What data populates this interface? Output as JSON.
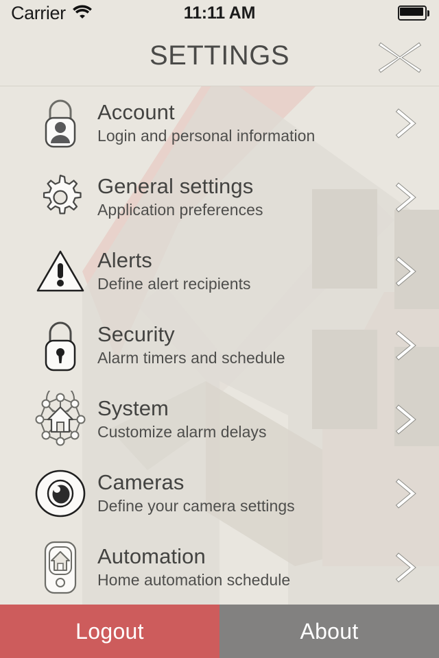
{
  "status_bar": {
    "carrier": "Carrier",
    "wifi_icon": "wifi-icon",
    "time": "11:11 AM",
    "battery_icon": "battery-full-icon"
  },
  "header": {
    "title": "SETTINGS",
    "close_icon": "close-x-icon"
  },
  "colors": {
    "background": "#E9E6DF",
    "watermark_gray": "#DAD7D0",
    "watermark_pink": "#E8D2CB",
    "title_text": "#4a4a48",
    "row_title_text": "#434341",
    "row_sub_text": "#4e4e4c",
    "logout_red": "#CD5C5C",
    "about_gray": "#828180",
    "icon_stroke": "#4a4a48"
  },
  "settings_list": [
    {
      "title": "Account",
      "subtitle": "Login and personal information",
      "icon": "padlock-person-icon",
      "chevron": "chevron-right-icon"
    },
    {
      "title": "General settings",
      "subtitle": "Application preferences",
      "icon": "gear-icon",
      "chevron": "chevron-right-icon"
    },
    {
      "title": "Alerts",
      "subtitle": "Define alert recipients",
      "icon": "warning-triangle-icon",
      "chevron": "chevron-right-icon"
    },
    {
      "title": "Security",
      "subtitle": "Alarm timers and schedule",
      "icon": "padlock-keyhole-icon",
      "chevron": "chevron-right-icon"
    },
    {
      "title": "System",
      "subtitle": "Customize alarm delays",
      "icon": "house-network-icon",
      "chevron": "chevron-right-icon"
    },
    {
      "title": "Cameras",
      "subtitle": "Define your camera settings",
      "icon": "eye-lens-icon",
      "chevron": "chevron-right-icon"
    },
    {
      "title": "Automation",
      "subtitle": "Home automation schedule",
      "icon": "phone-house-icon",
      "chevron": "chevron-right-icon"
    }
  ],
  "footer": {
    "logout_label": "Logout",
    "about_label": "About"
  }
}
